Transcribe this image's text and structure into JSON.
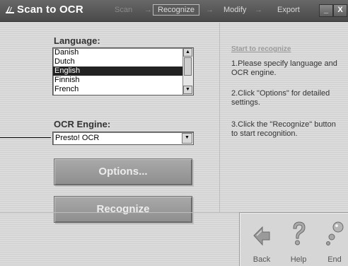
{
  "window": {
    "title": "Scan to OCR",
    "minimize_glyph": "_",
    "close_glyph": "X"
  },
  "steps": [
    {
      "label": "Scan"
    },
    {
      "label": "Recognize"
    },
    {
      "label": "Modify"
    },
    {
      "label": "Export"
    }
  ],
  "arrow_glyph": "→",
  "language": {
    "label": "Language:",
    "items": [
      "Danish",
      "Dutch",
      "English",
      "Finnish",
      "French"
    ],
    "selected": "English"
  },
  "ocr": {
    "label": "OCR Engine:",
    "value": "Presto! OCR"
  },
  "buttons": {
    "options": "Options...",
    "recognize": "Recognize"
  },
  "help": {
    "title": "Start to recognize",
    "steps": [
      "1.Please specify language and OCR engine.",
      "2.Click \"Options\" for detailed settings.",
      "3.Click the \"Recognize\" button to start recognition."
    ]
  },
  "nav": {
    "back": "Back",
    "help": "Help",
    "end": "End"
  },
  "colors": {
    "selection": "#222222",
    "button_face": "#9c9c9c",
    "titlebar": "#555555"
  }
}
